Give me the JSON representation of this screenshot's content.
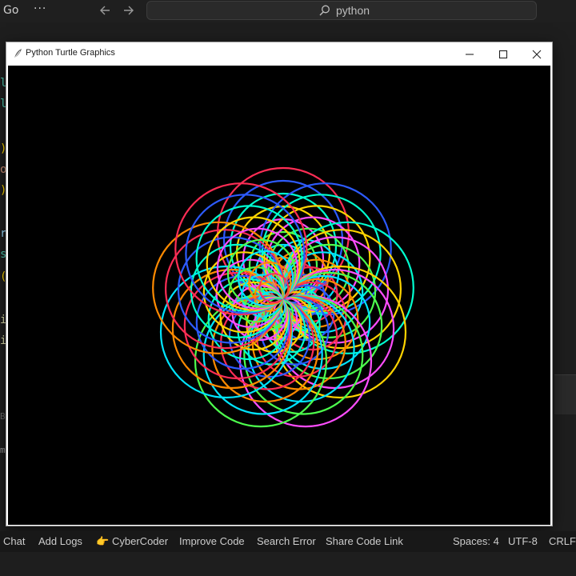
{
  "topbar": {
    "go_menu": "Go",
    "more": "···",
    "search_text": "python"
  },
  "turtle_window": {
    "title": "Python Turtle Graphics"
  },
  "statusbar": {
    "chat": "Chat",
    "add_logs": "Add Logs",
    "cybercoder": "CyberCoder",
    "cybercoder_emoji": "👉",
    "improve_code": "Improve Code",
    "search_error": "Search Error",
    "share_code_link": "Share Code Link",
    "spaces": "Spaces: 4",
    "encoding": "UTF-8",
    "line_ending": "CRLF"
  },
  "colors": {
    "editor_bg": "#1e1e1e",
    "canvas_bg": "#000000",
    "palette": [
      "#ff2d55",
      "#2d5bff",
      "#00ffd0",
      "#ffd400",
      "#ff4dff",
      "#4dff4d",
      "#00e5ff",
      "#ff8a00"
    ]
  },
  "icons": {
    "app": "feather-icon",
    "search": "search-icon",
    "back": "arrow-left-icon",
    "forward": "arrow-right-icon",
    "minimize": "minimize-icon",
    "maximize": "maximize-icon",
    "close": "close-icon"
  },
  "drawing": {
    "petals": 9,
    "rings": 9
  }
}
